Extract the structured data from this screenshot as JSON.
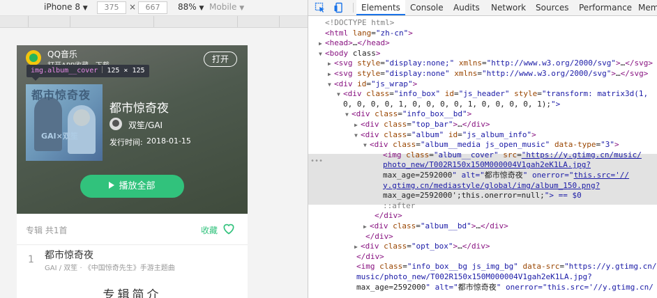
{
  "device_toolbar": {
    "device": "iPhone 8",
    "width": "375",
    "times": "×",
    "height": "667",
    "zoom": "88%",
    "mode": "Mobile"
  },
  "phone": {
    "top_bar": {
      "app_name": "QQ音乐",
      "app_sub": "打开APP收藏，下载",
      "open_label": "打开"
    },
    "tooltip": {
      "selector": "img.album__cover",
      "size": "125 × 125"
    },
    "album": {
      "cover_text": "都市惊奇夜",
      "cover_gai": "GAI×双笙",
      "title": "都市惊奇夜",
      "singer": "双笙/GAI",
      "release_label": "发行时间:",
      "release_date": "2018-01-15"
    },
    "play_label": "播放全部",
    "list_head": {
      "label": "专辑 共1首",
      "fav_label": "收藏"
    },
    "track": {
      "num": "1",
      "title": "都市惊奇夜",
      "sub": "GAI / 双笙 · 《中国惊奇先生》手游主题曲"
    },
    "intro_heading": "专辑简介",
    "colors": {
      "accent": "#31c27c"
    }
  },
  "devtools": {
    "tabs": [
      "Elements",
      "Console",
      "Audits",
      "Network",
      "Sources",
      "Performance",
      "Mem"
    ],
    "active_tab": "Elements",
    "lines": [
      "<!DOCTYPE html>",
      "<html lang=\"zh-cn\">",
      "<head>…</head>",
      "<body class>",
      "<svg style=\"display:none;\" xmlns=\"http://www.w3.org/2000/svg\">…</svg>",
      "<svg style=\"display:none\" xmlns=\"http://www.w3.org/2000/svg\">…</svg>",
      "<div id=\"js_wrap\">",
      "<div class=\"info_box\" id=\"js_header\" style=\"transform: matrix3d(1,",
      "0, 0, 0, 0, 1, 0, 0, 0, 0, 1, 0, 0, 0, 0, 1);\">",
      "<div class=\"info_box__bd\">",
      "<div class=\"top_bar\">…</div>",
      "<div class=\"album\" id=\"js_album_info\">",
      "<div class=\"album__media js_open_music\" data-type=\"3\">",
      "<img class=\"album__cover\" src=\"https://y.gtimg.cn/music/",
      "photo_new/T002R150x150M000004V1gah2eK1LA.jpg?",
      "max_age=2592000\" alt=\"都市惊奇夜\" onerror=\"this.src='//",
      "y.gtimg.cn/mediastyle/global/img/album_150.png?",
      "max_age=2592000';this.onerror=null;\"> == $0",
      "::after",
      "</div>",
      "<div class=\"album__bd\">…</div>",
      "</div>",
      "<div class=\"opt_box\">…</div>",
      "</div>",
      "<img class=\"info_box__bg js_img_bg\" data-src=\"https://y.gtimg.cn/",
      "music/photo_new/T002R150x150M000004V1gah2eK1LA.jpg?",
      "max_age=2592000\" alt=\"都市惊奇夜\" onerror=\"this.src='//y.gtimg.cn/"
    ]
  }
}
